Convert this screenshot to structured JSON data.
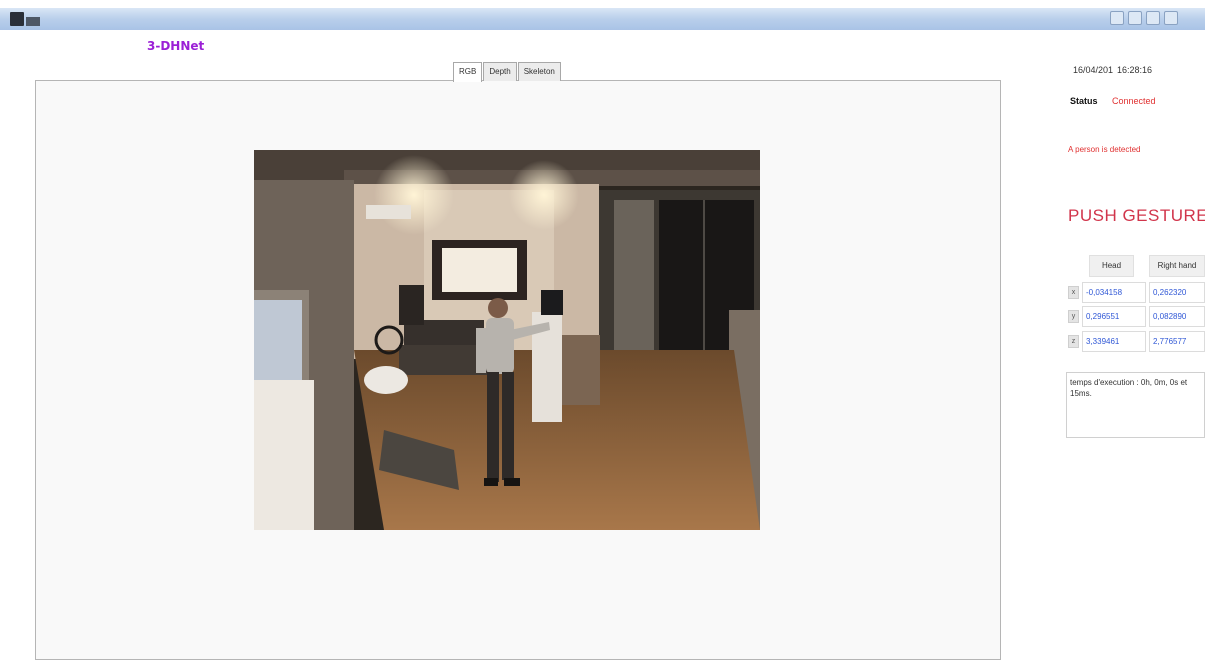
{
  "window": {
    "app_icon": "kinect-app-icon",
    "window_controls": [
      "minimize-icon",
      "restore-icon",
      "maximize-icon",
      "close-icon"
    ]
  },
  "header": {
    "logo": "3-DHNet"
  },
  "tabs": [
    {
      "label": "RGB",
      "active": true
    },
    {
      "label": "Depth",
      "active": false
    },
    {
      "label": "Skeleton",
      "active": false
    }
  ],
  "side": {
    "date": "16/04/201",
    "time": "16:28:16",
    "status_label": "Status",
    "status_value": "Connected",
    "detection_message": "A person is detected",
    "gesture": "PUSH GESTURE",
    "table": {
      "columns": [
        "Head",
        "Right hand"
      ],
      "rows": [
        {
          "label": "x",
          "values": [
            "-0,034158",
            "0,262320"
          ]
        },
        {
          "label": "y",
          "values": [
            "0,296551",
            "0,082890"
          ]
        },
        {
          "label": "z",
          "values": [
            "3,339461",
            "2,776577"
          ]
        }
      ]
    },
    "execution_time": "temps d'execution : 0h, 0m, 0s et 15ms."
  },
  "colors": {
    "logo": "#9b1fd6",
    "status": "#e03030",
    "gesture": "#d1354b",
    "values": "#2f57d6"
  }
}
